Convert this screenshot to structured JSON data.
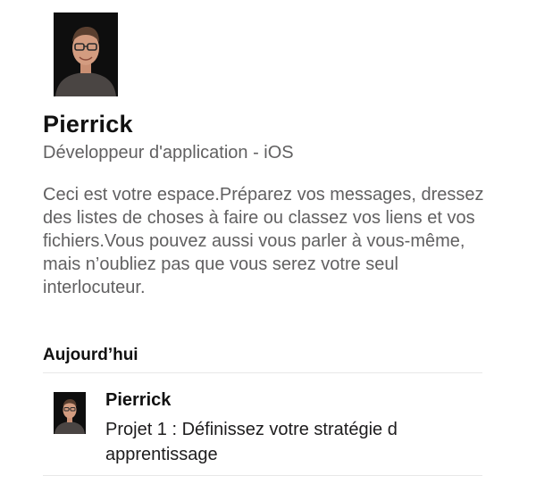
{
  "profile": {
    "avatar_icon": "user-avatar",
    "name": "Pierrick",
    "title": "Développeur d'application - iOS"
  },
  "intro": {
    "text": "Ceci est votre espace.Préparez vos messages, dressez des listes de choses à faire ou classez vos liens et vos fichiers.Vous pouvez aussi vous parler à vous-même, mais n’oubliez pas que vous serez votre seul interlocuteur."
  },
  "messages": {
    "day_label": "Aujourd’hui",
    "items": [
      {
        "sender": "Pierrick",
        "text": "Projet 1 : Définissez votre stratégie d apprentissage",
        "avatar_icon": "user-avatar"
      }
    ]
  }
}
